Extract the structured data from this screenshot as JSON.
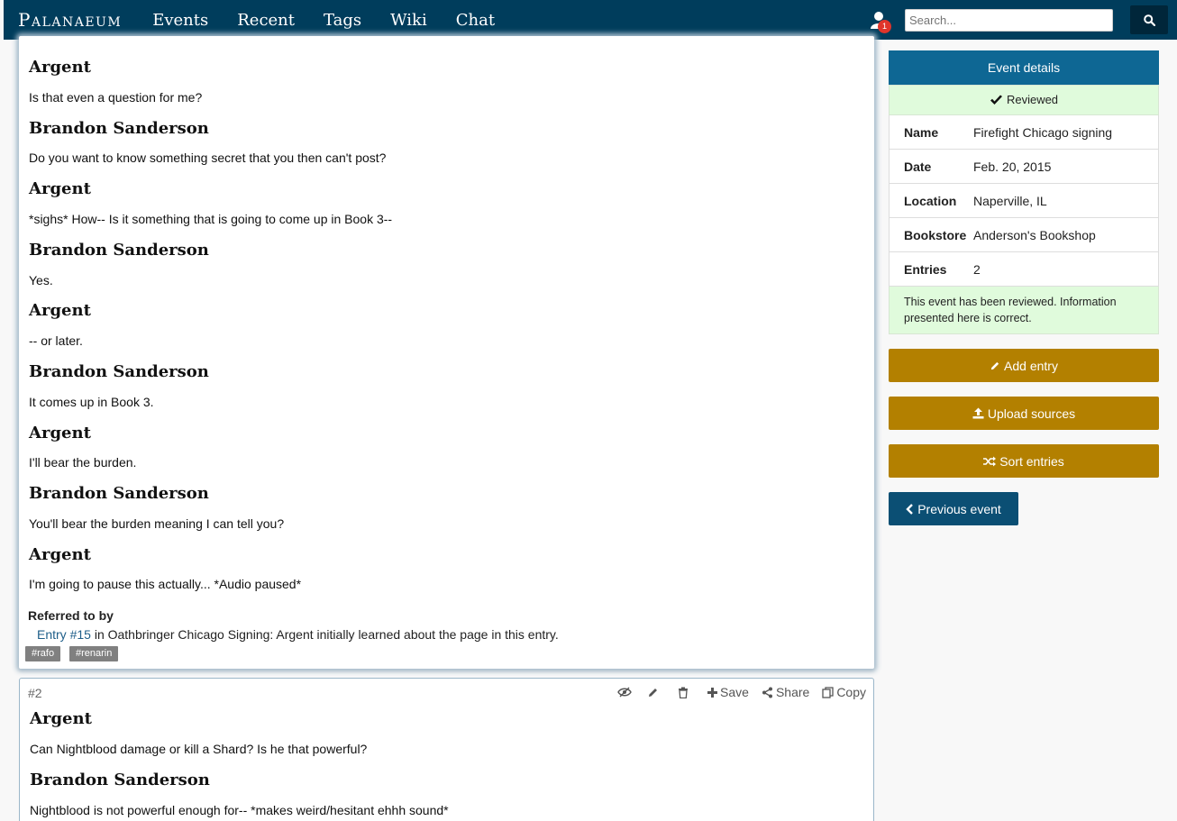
{
  "nav": {
    "brand": "Palanaeum",
    "links": [
      "Events",
      "Recent",
      "Tags",
      "Wiki",
      "Chat"
    ],
    "notification_count": "1",
    "search_placeholder": "Search..."
  },
  "entry1": {
    "dialogue": [
      {
        "speaker": "Argent",
        "text": "Is that even a question for me?"
      },
      {
        "speaker": "Brandon Sanderson",
        "text": "Do you want to know something secret that you then can't post?"
      },
      {
        "speaker": "Argent",
        "text": "*sighs* How-- Is it something that is going to come up in Book 3--"
      },
      {
        "speaker": "Brandon Sanderson",
        "text": "Yes."
      },
      {
        "speaker": "Argent",
        "text": "-- or later."
      },
      {
        "speaker": "Brandon Sanderson",
        "text": "It comes up in Book 3."
      },
      {
        "speaker": "Argent",
        "text": "I'll bear the burden."
      },
      {
        "speaker": "Brandon Sanderson",
        "text": "You'll bear the burden meaning I can tell you?"
      },
      {
        "speaker": "Argent",
        "text": "I'm going to pause this actually... *Audio paused*"
      }
    ],
    "referred_title": "Referred to by",
    "referred_link": "Entry #15",
    "referred_text": " in Oathbringer Chicago Signing: Argent initially learned about the page in this entry.",
    "tags": [
      "#rafo",
      "#renarin"
    ]
  },
  "entry2": {
    "number": "#2",
    "tools": {
      "save": "Save",
      "share": "Share",
      "copy": "Copy"
    },
    "dialogue": [
      {
        "speaker": "Argent",
        "text": "Can Nightblood damage or kill a Shard? Is he that powerful?"
      },
      {
        "speaker": "Brandon Sanderson",
        "text": "Nightblood is not powerful enough for-- *makes weird/hesitant ehhh sound*"
      }
    ]
  },
  "sidebar": {
    "header": "Event details",
    "status": "Reviewed",
    "rows": [
      {
        "key": "Name",
        "value": "Firefight Chicago signing"
      },
      {
        "key": "Date",
        "value": "Feb. 20, 2015"
      },
      {
        "key": "Location",
        "value": "Naperville, IL"
      },
      {
        "key": "Bookstore",
        "value": "Anderson's Bookshop"
      },
      {
        "key": "Entries",
        "value": "2"
      }
    ],
    "note": "This event has been reviewed. Information presented here is correct.",
    "buttons": {
      "add_entry": "Add entry",
      "upload_sources": "Upload sources",
      "sort_entries": "Sort entries",
      "previous_event": "Previous event"
    }
  },
  "colors": {
    "navbar": "#003d5c",
    "accent_gold": "#b38000",
    "header_blue": "#0e6794",
    "reviewed_green": "#e0fbdc"
  }
}
